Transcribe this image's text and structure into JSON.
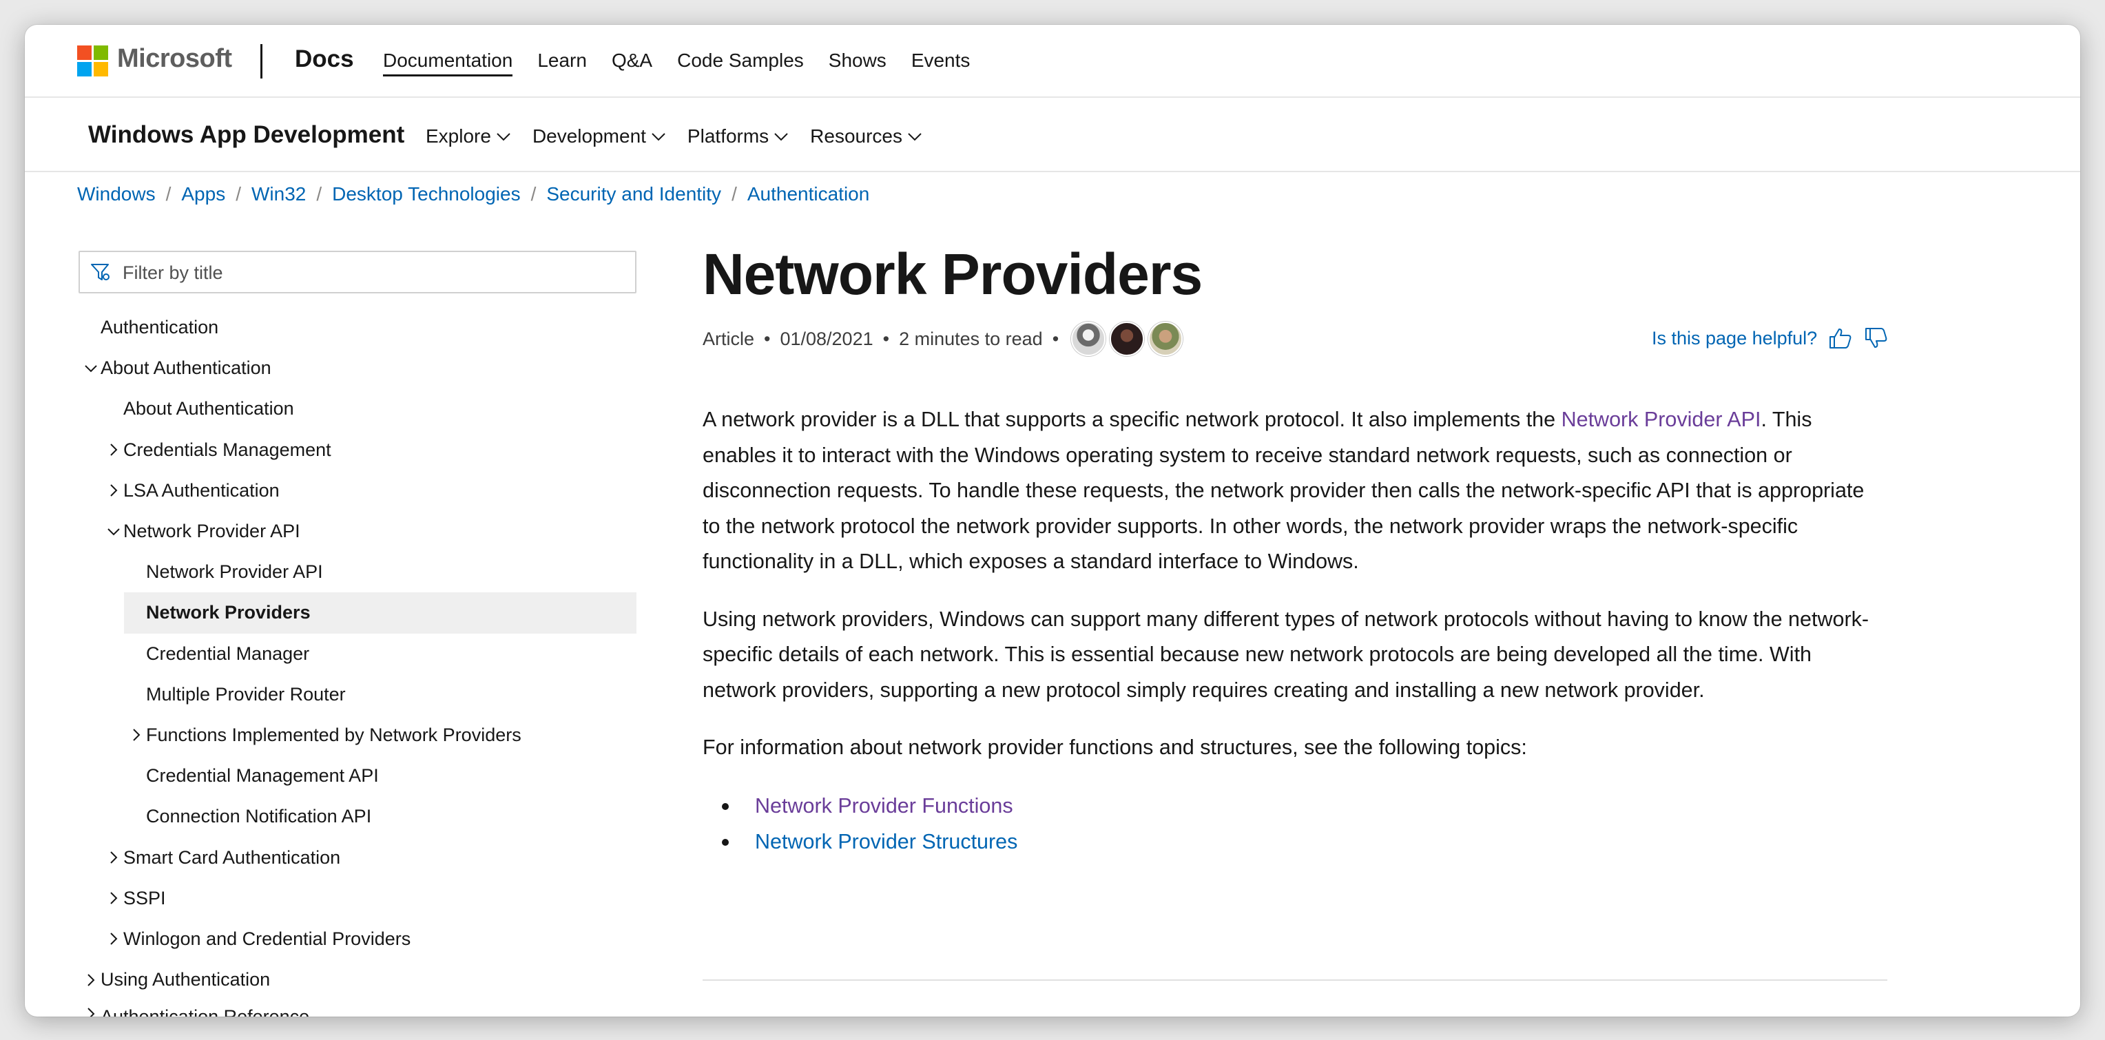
{
  "header": {
    "brand": "Microsoft",
    "product": "Docs",
    "nav": [
      "Documentation",
      "Learn",
      "Q&A",
      "Code Samples",
      "Shows",
      "Events"
    ],
    "logo_colors": [
      "#f25022",
      "#7fba00",
      "#00a4ef",
      "#ffb900"
    ]
  },
  "subheader": {
    "title": "Windows App Development",
    "menus": [
      "Explore",
      "Development",
      "Platforms",
      "Resources"
    ]
  },
  "breadcrumb": [
    "Windows",
    "Apps",
    "Win32",
    "Desktop Technologies",
    "Security and Identity",
    "Authentication"
  ],
  "sidebar": {
    "filter_placeholder": "Filter by title",
    "items": [
      {
        "label": "Authentication",
        "level": 0,
        "chevron": "none"
      },
      {
        "label": "About Authentication",
        "level": 0,
        "chevron": "down"
      },
      {
        "label": "About Authentication",
        "level": 1,
        "chevron": "none"
      },
      {
        "label": "Credentials Management",
        "level": 1,
        "chevron": "right"
      },
      {
        "label": "LSA Authentication",
        "level": 1,
        "chevron": "right"
      },
      {
        "label": "Network Provider API",
        "level": 1,
        "chevron": "down"
      },
      {
        "label": "Network Provider API",
        "level": 2,
        "chevron": "none"
      },
      {
        "label": "Network Providers",
        "level": 2,
        "chevron": "none",
        "selected": true
      },
      {
        "label": "Credential Manager",
        "level": 2,
        "chevron": "none"
      },
      {
        "label": "Multiple Provider Router",
        "level": 2,
        "chevron": "none"
      },
      {
        "label": "Functions Implemented by Network Providers",
        "level": 2,
        "chevron": "right"
      },
      {
        "label": "Credential Management API",
        "level": 2,
        "chevron": "none"
      },
      {
        "label": "Connection Notification API",
        "level": 2,
        "chevron": "none"
      },
      {
        "label": "Smart Card Authentication",
        "level": 1,
        "chevron": "right"
      },
      {
        "label": "SSPI",
        "level": 1,
        "chevron": "right"
      },
      {
        "label": "Winlogon and Credential Providers",
        "level": 1,
        "chevron": "right"
      },
      {
        "label": "Using Authentication",
        "level": 0,
        "chevron": "right"
      },
      {
        "label": "Authentication Reference",
        "level": 0,
        "chevron": "right",
        "clipped": true
      }
    ]
  },
  "article": {
    "title": "Network Providers",
    "type": "Article",
    "date": "01/08/2021",
    "read_time": "2 minutes to read",
    "helpful_prompt": "Is this page helpful?",
    "para1_before": "A network provider is a DLL that supports a specific network protocol. It also implements the ",
    "para1_link": "Network Provider API",
    "para1_after": ". This enables it to interact with the Windows operating system to receive standard network requests, such as connection or disconnection requests. To handle these requests, the network provider then calls the network-specific API that is appropriate to the network protocol the network provider supports. In other words, the network provider wraps the network-specific functionality in a DLL, which exposes a standard interface to Windows.",
    "para2": "Using network providers, Windows can support many different types of network protocols without having to know the network-specific details of each network. This is essential because new network protocols are being developed all the time. With network providers, supporting a new protocol simply requires creating and installing a new network provider.",
    "para3": "For information about network provider functions and structures, see the following topics:",
    "links": [
      {
        "label": "Network Provider Functions",
        "visited": true
      },
      {
        "label": "Network Provider Structures",
        "visited": false
      }
    ]
  },
  "colors": {
    "link": "#0065b3",
    "visited_link": "#6a3d99",
    "text": "#171717",
    "selected_bg": "#efefef"
  }
}
